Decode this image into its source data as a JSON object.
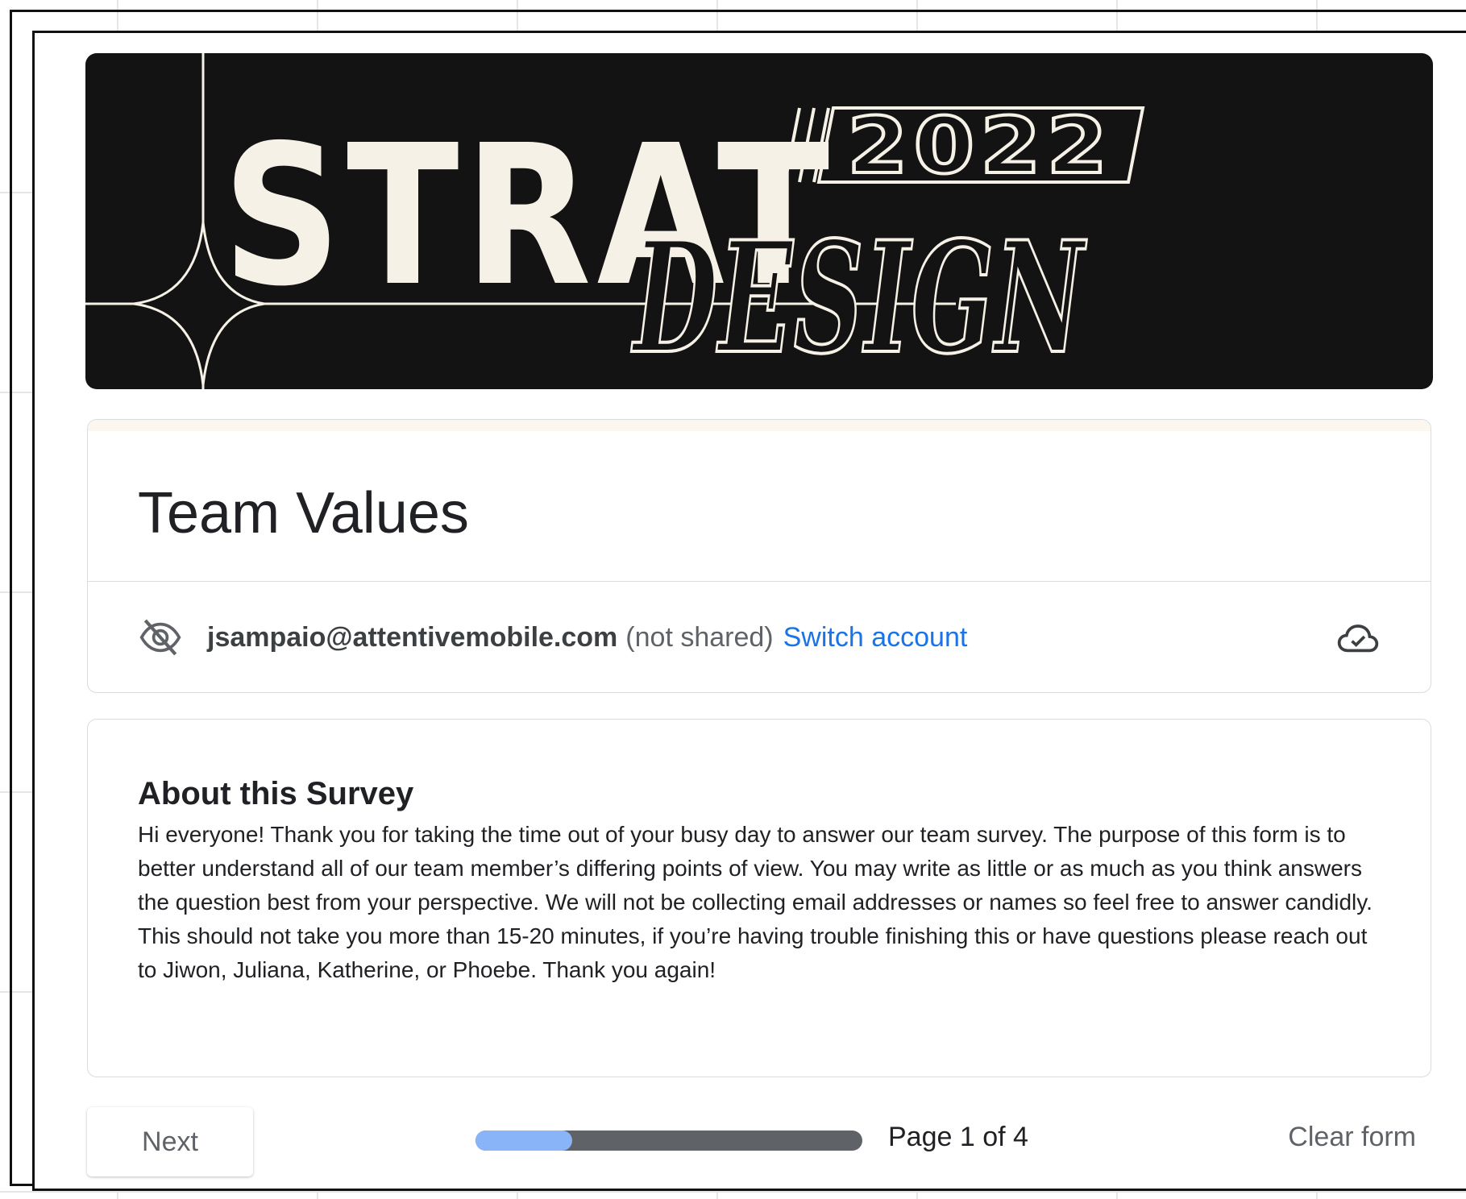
{
  "banner": {
    "logo_title": "STRAT",
    "logo_year": "2022",
    "logo_subtitle": "DESIGN"
  },
  "form": {
    "title": "Team Values",
    "account": {
      "email": "jsampaio@attentivemobile.com",
      "not_shared": "(not shared)",
      "switch_label": "Switch account",
      "hidden_icon": "eye-off-icon",
      "save_icon": "cloud-check-icon"
    }
  },
  "description": {
    "heading": "About this Survey",
    "body": "Hi everyone! Thank you for taking the time out of your busy day to answer our team survey. The purpose of this form is to better understand all of our team member’s differing points of view. You may write as little or as much as you think answers the question best from your perspective. We will not be collecting email addresses or names so feel free to answer candidly. This should not take you more than 15-20 minutes, if you’re having trouble finishing this or have questions please reach out to Jiwon, Juliana, Katherine, or Phoebe. Thank you again!"
  },
  "footer": {
    "next_label": "Next",
    "page_label": "Page 1 of 4",
    "progress_fraction": 0.25,
    "clear_label": "Clear form"
  },
  "colors": {
    "link": "#1a73e8",
    "progress_fill": "#8ab4f8",
    "progress_track": "#5f6368",
    "banner_bg": "#131313",
    "banner_ink": "#f6f1e6"
  }
}
